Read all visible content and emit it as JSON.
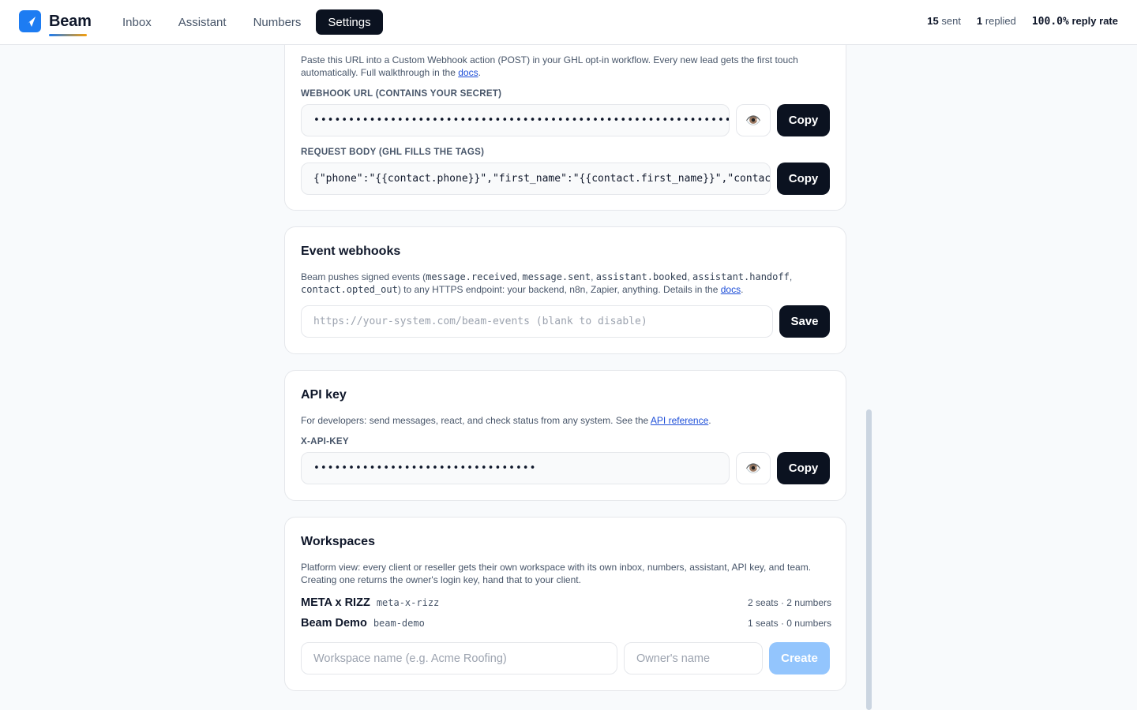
{
  "header": {
    "brand": "Beam",
    "nav": [
      {
        "label": "Inbox",
        "active": false
      },
      {
        "label": "Assistant",
        "active": false
      },
      {
        "label": "Numbers",
        "active": false
      },
      {
        "label": "Settings",
        "active": true
      }
    ],
    "stats": {
      "sent_count": "15",
      "sent_label": "sent",
      "replied_count": "1",
      "replied_label": "replied",
      "rate_value": "100.0%",
      "rate_label": "reply rate"
    }
  },
  "optin": {
    "desc_text": "Paste this URL into a Custom Webhook action (POST) in your GHL opt-in workflow. Every new lead gets the first touch automatically. Full walkthrough in the ",
    "desc_link": "docs",
    "url_label": "Webhook URL (contains your secret)",
    "url_value": "••••••••••••••••••••••••••••••••••••••••••••••••••••••••••••••••••",
    "body_label": "Request body (GHL fills the tags)",
    "body_value": "{\"phone\":\"{{contact.phone}}\",\"first_name\":\"{{contact.first_name}}\",\"contact_id\":\"{{contact.id}}\"}",
    "copy_label": "Copy"
  },
  "event_webhooks": {
    "title": "Event webhooks",
    "desc_pre": "Beam pushes signed events (",
    "events": [
      "message.received",
      "message.sent",
      "assistant.booked",
      "assistant.handoff",
      "contact.opted_out"
    ],
    "desc_post": ") to any HTTPS endpoint: your backend, n8n, Zapier, anything. Details in the ",
    "desc_link": "docs",
    "placeholder": "https://your-system.com/beam-events (blank to disable)",
    "save_label": "Save"
  },
  "api_key": {
    "title": "API key",
    "desc_text": "For developers: send messages, react, and check status from any system. See the ",
    "desc_link": "API reference",
    "key_label": "X-API-KEY",
    "key_value": "••••••••••••••••••••••••••••••••",
    "copy_label": "Copy"
  },
  "workspaces": {
    "title": "Workspaces",
    "desc": "Platform view: every client or reseller gets their own workspace with its own inbox, numbers, assistant, API key, and team. Creating one returns the owner's login key, hand that to your client.",
    "items": [
      {
        "name": "META x RIZZ",
        "slug": "meta-x-rizz",
        "meta": "2 seats · 2 numbers"
      },
      {
        "name": "Beam Demo",
        "slug": "beam-demo",
        "meta": "1 seats · 0 numbers"
      }
    ],
    "name_placeholder": "Workspace name (e.g. Acme Roofing)",
    "owner_placeholder": "Owner's name",
    "create_label": "Create"
  },
  "colors": {
    "accent": "#1d7cf2",
    "dark_button": "#0b1220",
    "create_disabled": "#93c5fd"
  }
}
